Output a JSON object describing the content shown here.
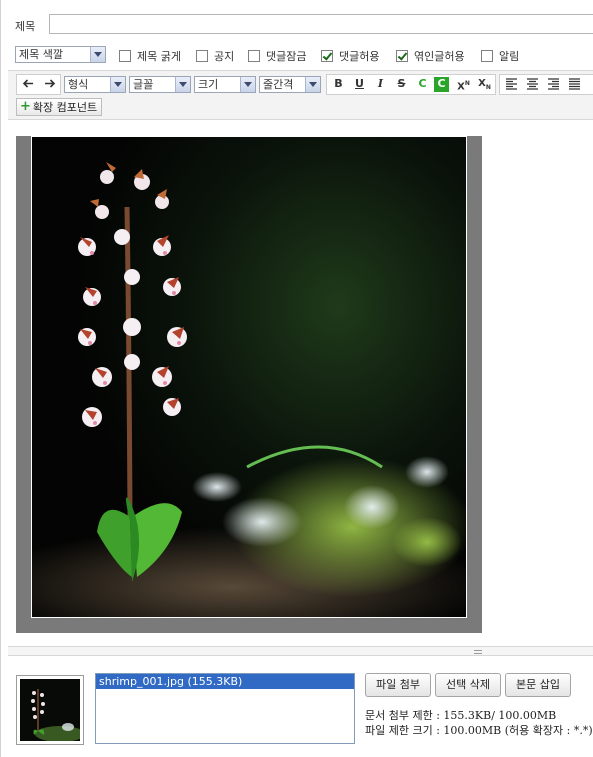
{
  "title_row": {
    "label": "제목",
    "input_value": ""
  },
  "options": {
    "color_select": "제목 색깔",
    "checkboxes": [
      {
        "label": "제목 굵게",
        "checked": false
      },
      {
        "label": "공지",
        "checked": false
      },
      {
        "label": "댓글잠금",
        "checked": false
      },
      {
        "label": "댓글허용",
        "checked": true
      },
      {
        "label": "엮인글허용",
        "checked": true
      },
      {
        "label": "알림",
        "checked": false
      }
    ]
  },
  "toolbar": {
    "undo_icon": "arrow-left-icon",
    "redo_icon": "arrow-right-icon",
    "selects": [
      "형식",
      "글꼴",
      "크기",
      "줄간격"
    ],
    "bold": "B",
    "underline": "U",
    "italic": "I",
    "strike": "S",
    "font_color": "C",
    "bg_color": "C",
    "superscript": "X",
    "superscript_mark": "N",
    "subscript": "X",
    "subscript_mark": "N",
    "extension_button": "확장 컴포넌트",
    "colors": {
      "font_color": "#2aa52a",
      "bg_color_fill": "#2aa52a"
    }
  },
  "attachments": {
    "files": [
      "shrimp_001.jpg (155.3KB)"
    ],
    "attach_button": "파일 첨부",
    "delete_button": "선택 삭제",
    "insert_button": "본문 삽입",
    "doc_limit": "문서 첨부 제한 : 155.3KB/ 100.00MB",
    "file_limit": "파일 제한 크기 : 100.00MB (허용 확장자 : *.*)"
  }
}
